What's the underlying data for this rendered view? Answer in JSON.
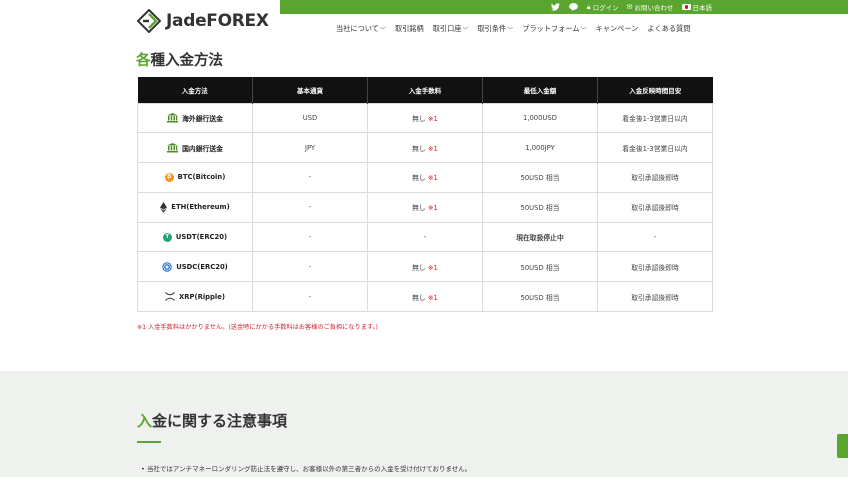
{
  "topbar": {
    "login": "ログイン",
    "contact": "お問い合わせ",
    "language": "日本語"
  },
  "logo": {
    "part1": "Jade",
    "part2": "FOREX"
  },
  "nav": [
    {
      "label": "当社について",
      "dropdown": true
    },
    {
      "label": "取引銘柄",
      "dropdown": false
    },
    {
      "label": "取引口座",
      "dropdown": true
    },
    {
      "label": "取引条件",
      "dropdown": true
    },
    {
      "label": "プラットフォーム",
      "dropdown": true
    },
    {
      "label": "キャンペーン",
      "dropdown": false
    },
    {
      "label": "よくある質問",
      "dropdown": false
    }
  ],
  "section1": {
    "title_accent": "各",
    "title_rest": "種入金方法"
  },
  "table": {
    "headers": [
      "入金方法",
      "基本通貨",
      "入金手数料",
      "最低入金額",
      "入金反映時間目安"
    ],
    "rows": [
      {
        "icon": "bank-icon",
        "method": "海外銀行送金",
        "currency": "USD",
        "fee": "無し",
        "fee_note": "※1",
        "min": "1,000USD",
        "time": "着金後1-3営業日以内"
      },
      {
        "icon": "bank-icon",
        "method": "国内銀行送金",
        "currency": "JPY",
        "fee": "無し",
        "fee_note": "※1",
        "min": "1,000JPY",
        "time": "着金後1-3営業日以内"
      },
      {
        "icon": "bitcoin-icon",
        "method": "BTC(Bitcoin)",
        "currency": "-",
        "fee": "無し",
        "fee_note": "※1",
        "min": "50USD 相当",
        "time": "取引承認後即時"
      },
      {
        "icon": "ethereum-icon",
        "method": "ETH(Ethereum)",
        "currency": "-",
        "fee": "無し",
        "fee_note": "※1",
        "min": "50USD 相当",
        "time": "取引承認後即時"
      },
      {
        "icon": "tether-icon",
        "method": "USDT(ERC20)",
        "currency": "-",
        "fee": "-",
        "fee_note": "",
        "min": "現在取扱停止中",
        "min_red": true,
        "time": "-"
      },
      {
        "icon": "usdc-icon",
        "method": "USDC(ERC20)",
        "currency": "-",
        "fee": "無し",
        "fee_note": "※1",
        "min": "50USD 相当",
        "time": "取引承認後即時"
      },
      {
        "icon": "ripple-icon",
        "method": "XRP(Ripple)",
        "currency": "-",
        "fee": "無し",
        "fee_note": "※1",
        "min": "50USD 相当",
        "time": "取引承認後即時"
      }
    ]
  },
  "footnote": "※1 入金手数料はかかりません。(送金時にかかる手数料はお客様のご負担になります。)",
  "section2": {
    "title_accent": "入",
    "title_rest": "金に関する注意事項",
    "bullet": "• 当社ではアンチマネーロンダリング防止法を遵守し、お客様以外の第三者からの入金を受け付けておりません。"
  },
  "colors": {
    "brand_green": "#5aa52f",
    "header_black": "#111111",
    "alert_red": "#d2222d"
  }
}
